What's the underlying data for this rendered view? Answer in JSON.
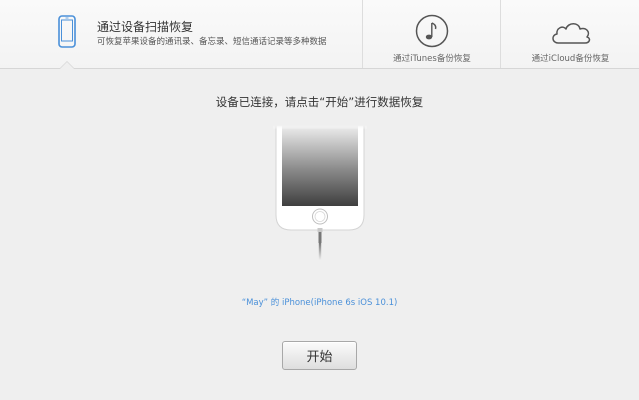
{
  "tabs": {
    "scan": {
      "title": "通过设备扫描恢复",
      "description": "可恢复苹果设备的通讯录、备忘录、短信通话记录等多种数据",
      "icon": "phone-icon"
    },
    "itunes": {
      "label": "通过iTunes备份恢复",
      "icon": "music-note-icon"
    },
    "icloud": {
      "label": "通过iCloud备份恢复",
      "icon": "cloud-icon"
    }
  },
  "main": {
    "instruction": "设备已连接，请点击“开始”进行数据恢复",
    "device_name": "“May” 的 iPhone(iPhone 6s iOS 10.1)",
    "start_label": "开始"
  },
  "colors": {
    "accent": "#4a90d9",
    "background": "#efefef"
  }
}
